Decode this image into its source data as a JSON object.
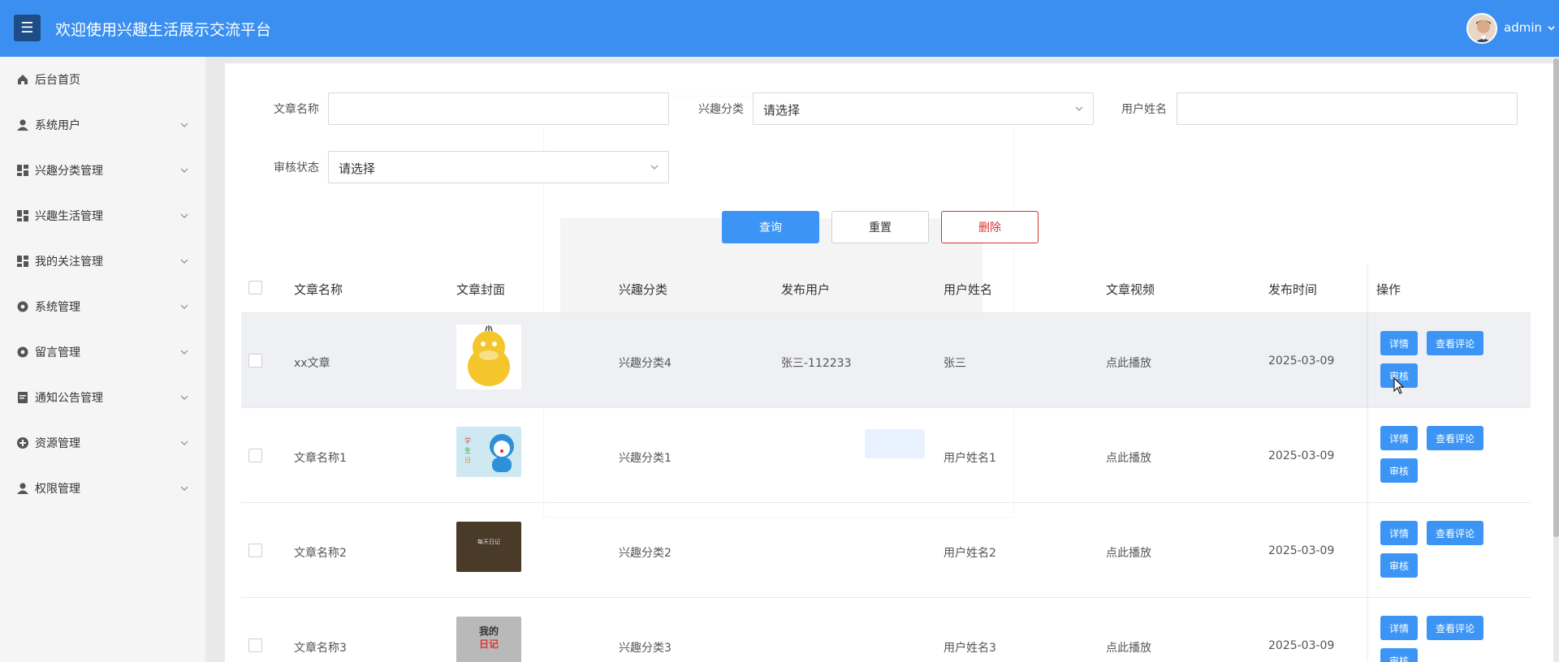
{
  "header": {
    "title": "欢迎使用兴趣生活展示交流平台",
    "menu_icon": "☰",
    "user": "admin"
  },
  "sidebar": {
    "items": [
      {
        "label": "后台首页",
        "icon": "home-icon",
        "expandable": false
      },
      {
        "label": "系统用户",
        "icon": "user-icon",
        "expandable": true
      },
      {
        "label": "兴趣分类管理",
        "icon": "dashboard-icon",
        "expandable": true
      },
      {
        "label": "兴趣生活管理",
        "icon": "dashboard-icon",
        "expandable": true
      },
      {
        "label": "我的关注管理",
        "icon": "dashboard-icon",
        "expandable": true
      },
      {
        "label": "系统管理",
        "icon": "gear-icon",
        "expandable": true
      },
      {
        "label": "留言管理",
        "icon": "gear-icon",
        "expandable": true
      },
      {
        "label": "通知公告管理",
        "icon": "document-icon",
        "expandable": true
      },
      {
        "label": "资源管理",
        "icon": "plus-circle-icon",
        "expandable": true
      },
      {
        "label": "权限管理",
        "icon": "user-icon",
        "expandable": true
      }
    ]
  },
  "filters": {
    "article_name_label": "文章名称",
    "article_name_value": "",
    "category_label": "兴趣分类",
    "category_value": "请选择",
    "username_label": "用户姓名",
    "username_value": "",
    "review_status_label": "审核状态",
    "review_status_value": "请选择"
  },
  "actions": {
    "search": "查询",
    "reset": "重置",
    "delete": "删除"
  },
  "table": {
    "columns": [
      "文章名称",
      "文章封面",
      "兴趣分类",
      "发布用户",
      "用户姓名",
      "文章视频",
      "发布时间",
      "操作"
    ],
    "row_buttons": {
      "detail": "详情",
      "comments": "查看评论",
      "review": "审核"
    },
    "rows": [
      {
        "name": "xx文章",
        "cover": "yellow-duck-cover",
        "category": "兴趣分类4",
        "publisher": "张三-112233",
        "username": "张三",
        "video": "点此播放",
        "date": "2025-03-09",
        "cover_text": ""
      },
      {
        "name": "文章名称1",
        "cover": "cartoon-cat-cover",
        "category": "兴趣分类1",
        "publisher": "",
        "username": "用户姓名1",
        "video": "点此播放",
        "date": "2025-03-09",
        "cover_text": ""
      },
      {
        "name": "文章名称2",
        "cover": "dark-diary-cover",
        "category": "兴趣分类2",
        "publisher": "",
        "username": "用户姓名2",
        "video": "点此播放",
        "date": "2025-03-09",
        "cover_text": "每天日记"
      },
      {
        "name": "文章名称3",
        "cover": "my-diary-cover",
        "category": "兴趣分类3",
        "publisher": "",
        "username": "用户姓名3",
        "video": "点此播放",
        "date": "2025-03-09",
        "cover_text": "我的日记"
      }
    ]
  },
  "colors": {
    "header_bg": "#3a8ff0",
    "menu_btn": "#1d4d86",
    "primary": "#3c95f4",
    "danger": "#d9302c"
  }
}
